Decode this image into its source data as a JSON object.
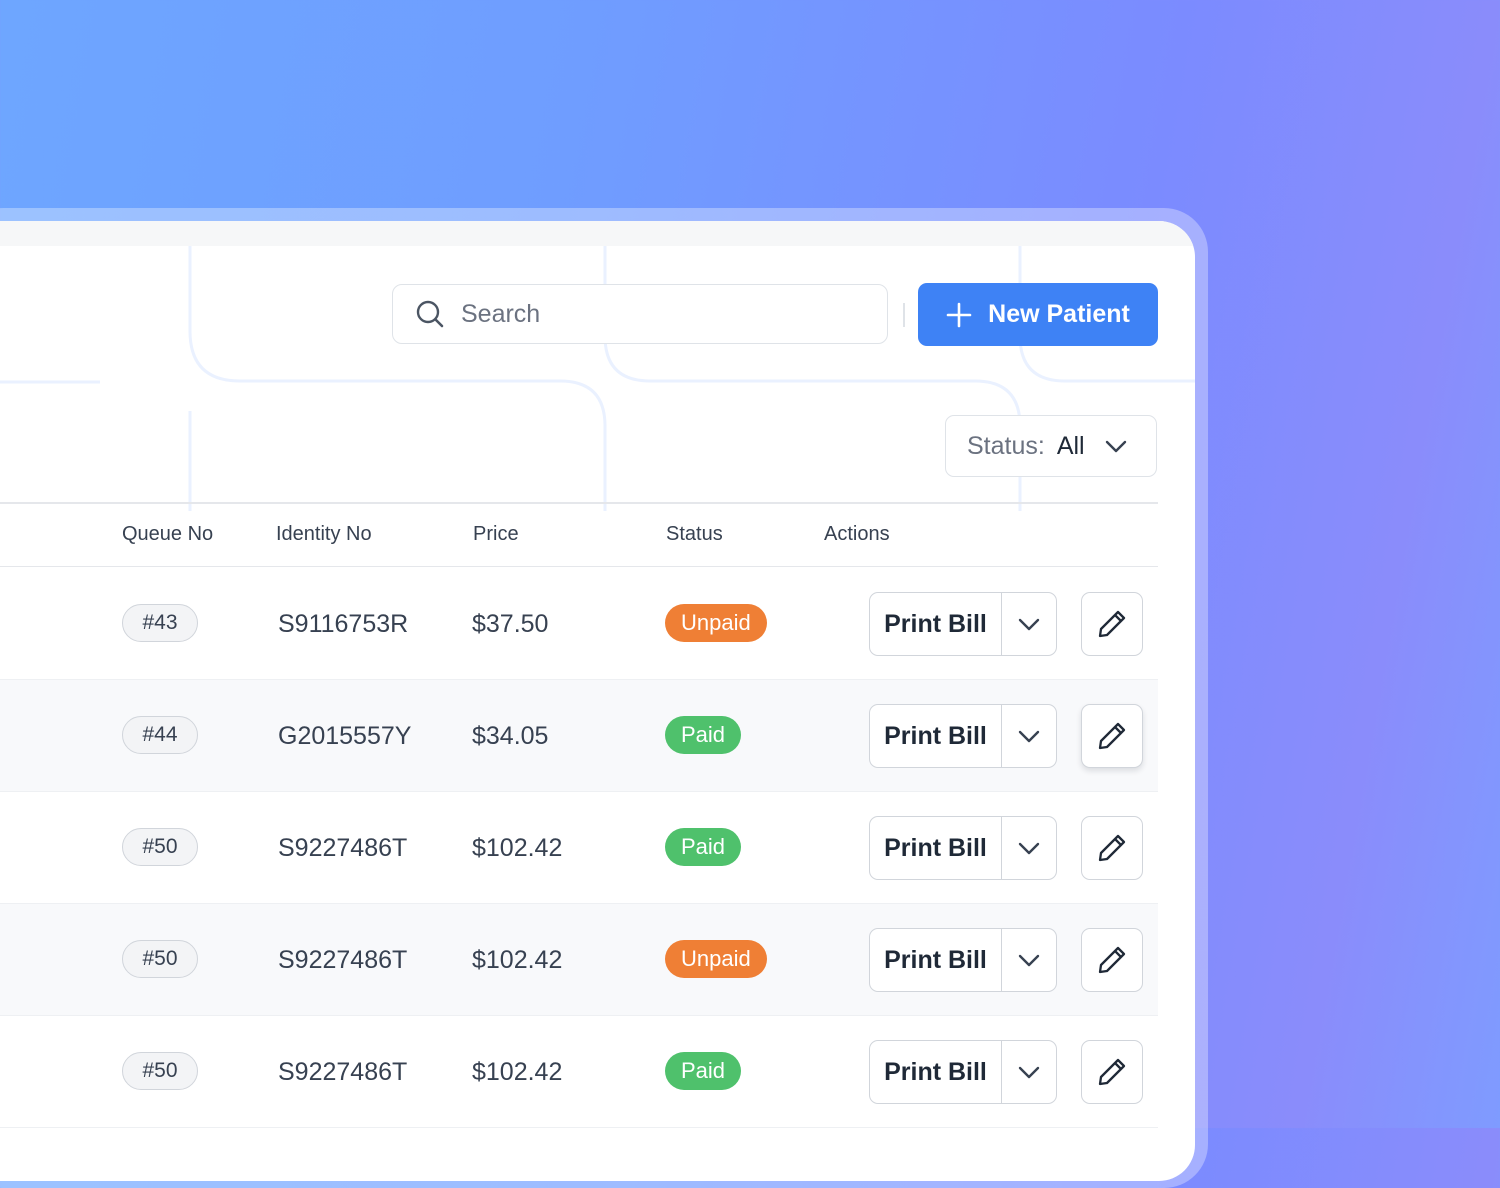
{
  "search": {
    "placeholder": "Search",
    "icon": "search-icon"
  },
  "toolbar": {
    "new_patient_label": "New Patient",
    "new_patient_icon": "plus-icon",
    "accent_color": "#3e82f5"
  },
  "filter": {
    "label": "Status:",
    "value": "All",
    "icon": "chevron-down-icon"
  },
  "table": {
    "columns": [
      "Queue No",
      "Identity No",
      "Price",
      "Status",
      "Actions"
    ],
    "rows": [
      {
        "queue": "#43",
        "identity": "S9116753R",
        "price": "$37.50",
        "status": "Unpaid",
        "action": "Print Bill"
      },
      {
        "queue": "#44",
        "identity": "G2015557Y",
        "price": "$34.05",
        "status": "Paid",
        "action": "Print Bill"
      },
      {
        "queue": "#50",
        "identity": "S9227486T",
        "price": "$102.42",
        "status": "Paid",
        "action": "Print Bill"
      },
      {
        "queue": "#50",
        "identity": "S9227486T",
        "price": "$102.42",
        "status": "Unpaid",
        "action": "Print Bill"
      },
      {
        "queue": "#50",
        "identity": "S9227486T",
        "price": "$102.42",
        "status": "Paid",
        "action": "Print Bill"
      }
    ]
  },
  "colors": {
    "unpaid": "#ef7f35",
    "paid": "#4fc16c"
  }
}
